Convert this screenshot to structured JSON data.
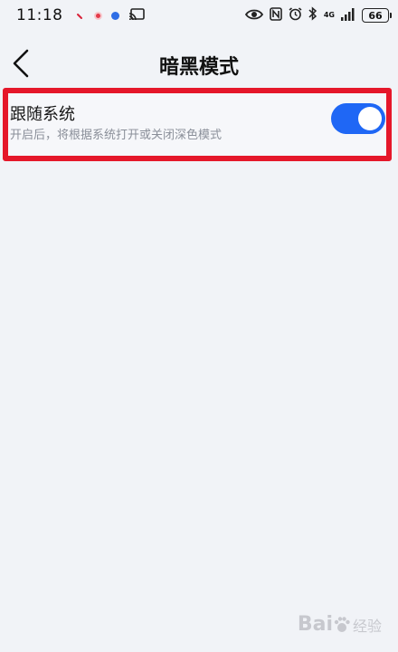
{
  "status_bar": {
    "time": "11:18",
    "network": "4G",
    "battery": "66"
  },
  "header": {
    "title": "暗黑模式"
  },
  "setting": {
    "title": "跟随系统",
    "description": "开启后，将根据系统打开或关闭深色模式",
    "toggle_on": true,
    "toggle_color": "#1f67f5"
  },
  "highlight_color": "#e5172a",
  "watermark": {
    "brand": "Bai",
    "suffix": "经验"
  }
}
